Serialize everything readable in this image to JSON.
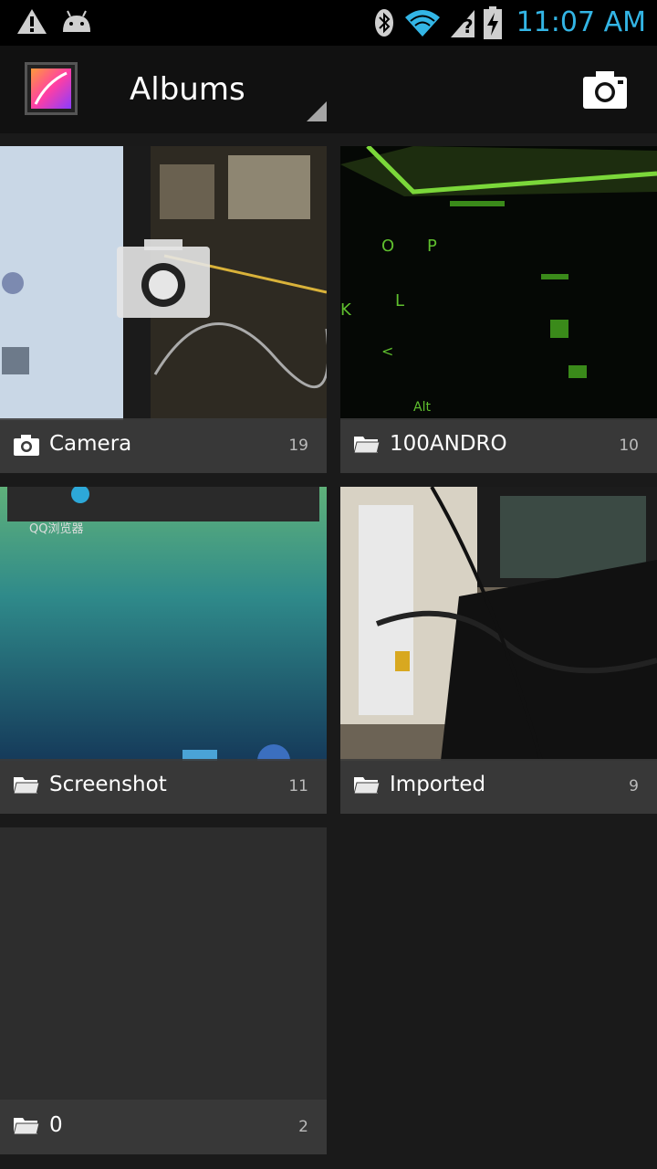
{
  "status_bar": {
    "time": "11:07 AM",
    "icons": [
      "warning-icon",
      "android-icon",
      "bluetooth-icon",
      "wifi-icon",
      "signal-unknown-icon",
      "battery-charging-icon"
    ],
    "accent_color": "#33b5e5"
  },
  "action_bar": {
    "title": "Albums",
    "app_icon": "gallery-icon",
    "action_icon": "camera-icon"
  },
  "albums": [
    {
      "name": "Camera",
      "count": "19",
      "icon": "camera-icon"
    },
    {
      "name": "100ANDRO",
      "count": "10",
      "icon": "folder-icon"
    },
    {
      "name": "Screenshot",
      "count": "11",
      "icon": "folder-icon"
    },
    {
      "name": "Imported",
      "count": "9",
      "icon": "folder-icon"
    },
    {
      "name": "0",
      "count": "2",
      "icon": "folder-icon"
    }
  ]
}
